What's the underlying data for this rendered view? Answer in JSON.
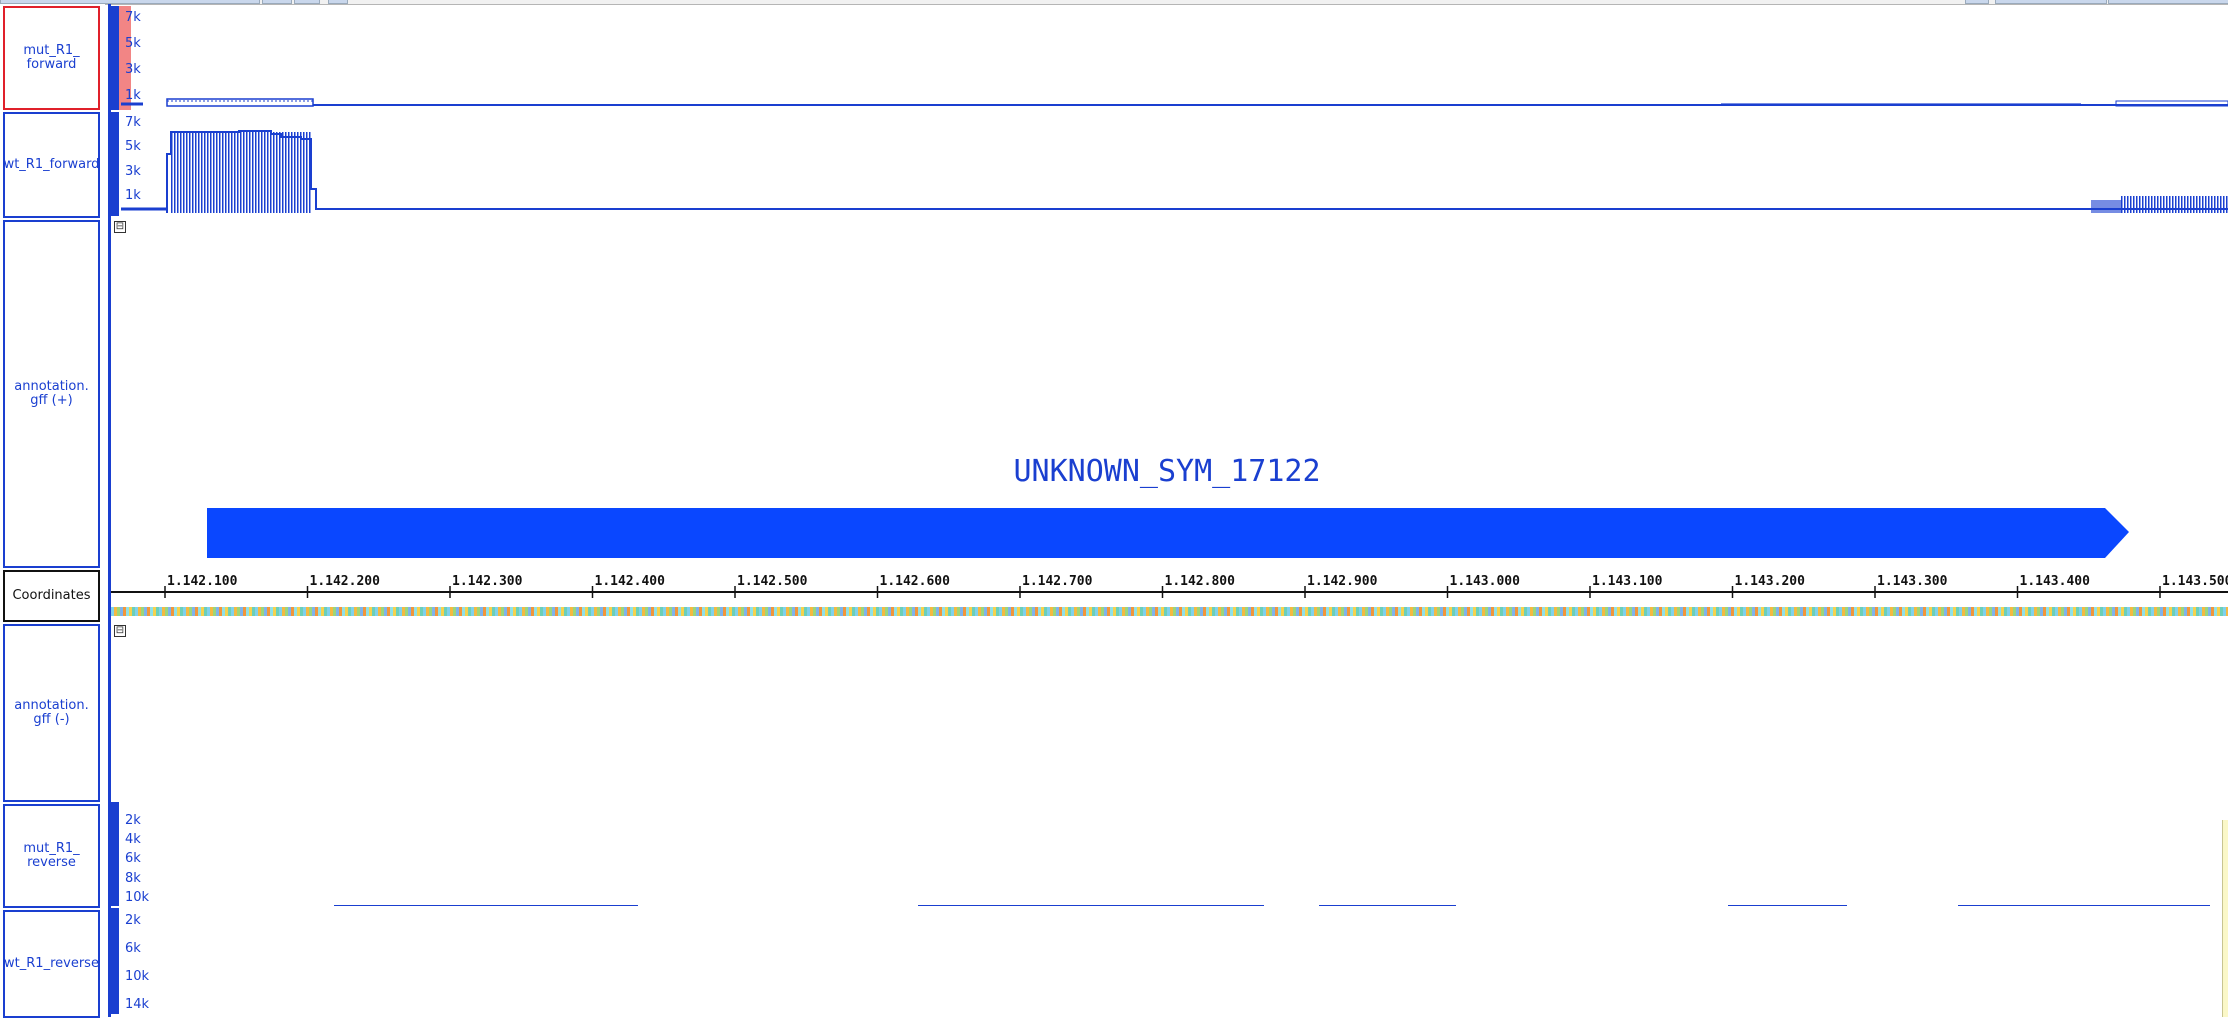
{
  "tracks": {
    "mut_forward": {
      "label": "mut_R1_\nforward",
      "ticks": [
        "7k",
        "5k",
        "3k",
        "1k"
      ]
    },
    "wt_forward": {
      "label": "wt_R1_forward",
      "ticks": [
        "7k",
        "5k",
        "3k",
        "1k"
      ]
    },
    "annot_plus": {
      "label": "annotation.\ngff (+)"
    },
    "coords": {
      "label": "Coordinates"
    },
    "annot_minus": {
      "label": "annotation.\ngff (-)"
    },
    "mut_reverse": {
      "label": "mut_R1_\nreverse",
      "ticks": [
        "2k",
        "4k",
        "6k",
        "8k",
        "10k"
      ]
    },
    "wt_reverse": {
      "label": "wt_R1_reverse",
      "ticks": [
        "2k",
        "6k",
        "10k",
        "14k"
      ]
    }
  },
  "gene": {
    "name": "UNKNOWN_SYM_17122",
    "strand": "+"
  },
  "coordinates": {
    "ticks": [
      "1.142.100",
      "1.142.200",
      "1.142.300",
      "1.142.400",
      "1.142.500",
      "1.142.600",
      "1.142.700",
      "1.142.800",
      "1.142.900",
      "1.143.000",
      "1.143.100",
      "1.143.200",
      "1.143.300",
      "1.143.400",
      "1.143.500"
    ]
  },
  "icons": {
    "collapse": "collapse-icon",
    "expander_glyph": "⊟"
  },
  "colors": {
    "track_blue": "#1a3fd0",
    "gene_blue": "#0a47ff",
    "selected_border": "#e0202a"
  }
}
